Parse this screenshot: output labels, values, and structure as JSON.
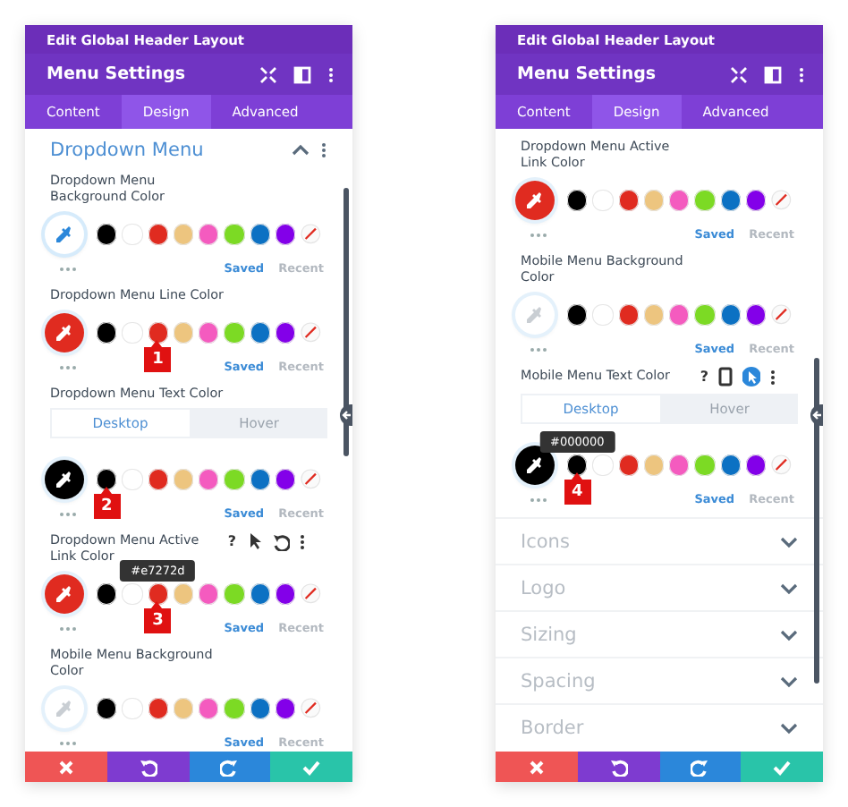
{
  "panels": [
    {
      "title": "Edit Global Header Layout",
      "subtitle": "Menu Settings",
      "tabs": [
        {
          "label": "Content",
          "selected": false
        },
        {
          "label": "Design",
          "selected": true
        },
        {
          "label": "Advanced",
          "selected": false
        }
      ],
      "items": [
        {
          "kind": "section",
          "label": "Dropdown Menu",
          "expanded": true
        },
        {
          "kind": "color",
          "label": "Dropdown Menu Background Color",
          "focused": true,
          "swatches": [
            {
              "kind": "color",
              "color": "#000000"
            },
            {
              "kind": "color",
              "color": "#ffffff"
            },
            {
              "kind": "color",
              "color": "#e02b20"
            },
            {
              "kind": "color",
              "color": "#edc57f"
            },
            {
              "kind": "color",
              "color": "#f45bbf"
            },
            {
              "kind": "color",
              "color": "#7cda24"
            },
            {
              "kind": "color",
              "color": "#0c71c3"
            },
            {
              "kind": "color",
              "color": "#8300e9"
            },
            {
              "kind": "clear"
            }
          ],
          "sources": [
            {
              "label": "Saved",
              "selected": true
            },
            {
              "label": "Recent",
              "selected": false
            }
          ]
        },
        {
          "kind": "color",
          "label": "Dropdown Menu Line Color",
          "color": "#e02b20",
          "focused": false,
          "swatches": [
            {
              "kind": "color",
              "color": "#000000"
            },
            {
              "kind": "color",
              "color": "#ffffff"
            },
            {
              "kind": "color",
              "color": "#e02b20",
              "callout": "1"
            },
            {
              "kind": "color",
              "color": "#edc57f"
            },
            {
              "kind": "color",
              "color": "#f45bbf"
            },
            {
              "kind": "color",
              "color": "#7cda24"
            },
            {
              "kind": "color",
              "color": "#0c71c3"
            },
            {
              "kind": "color",
              "color": "#8300e9"
            },
            {
              "kind": "clear"
            }
          ],
          "sources": [
            {
              "label": "Saved",
              "selected": true
            },
            {
              "label": "Recent",
              "selected": false
            }
          ]
        },
        {
          "kind": "color",
          "label": "Dropdown Menu Text Color",
          "color": "#000000",
          "focused": false,
          "devices": [
            {
              "label": "Desktop",
              "selected": true
            },
            {
              "label": "Hover",
              "selected": false
            }
          ],
          "swatches": [
            {
              "kind": "color",
              "color": "#000000",
              "callout": "2"
            },
            {
              "kind": "color",
              "color": "#ffffff"
            },
            {
              "kind": "color",
              "color": "#e02b20"
            },
            {
              "kind": "color",
              "color": "#edc57f"
            },
            {
              "kind": "color",
              "color": "#f45bbf"
            },
            {
              "kind": "color",
              "color": "#7cda24"
            },
            {
              "kind": "color",
              "color": "#0c71c3"
            },
            {
              "kind": "color",
              "color": "#8300e9"
            },
            {
              "kind": "clear"
            }
          ],
          "sources": [
            {
              "label": "Saved",
              "selected": true
            },
            {
              "label": "Recent",
              "selected": false
            }
          ]
        },
        {
          "kind": "color",
          "label": "Dropdown Menu Active Link Color",
          "color": "#e02b20",
          "focused": false,
          "tools": [
            {
              "kind": "help",
              "text": "?"
            },
            {
              "kind": "cursor",
              "active": false
            },
            {
              "kind": "reset"
            },
            {
              "kind": "more"
            }
          ],
          "swatches": [
            {
              "kind": "color",
              "color": "#000000"
            },
            {
              "kind": "color",
              "color": "#ffffff"
            },
            {
              "kind": "color",
              "color": "#e02b20",
              "tooltip": "#e7272d",
              "callout": "3"
            },
            {
              "kind": "color",
              "color": "#edc57f"
            },
            {
              "kind": "color",
              "color": "#f45bbf"
            },
            {
              "kind": "color",
              "color": "#7cda24"
            },
            {
              "kind": "color",
              "color": "#0c71c3"
            },
            {
              "kind": "color",
              "color": "#8300e9"
            },
            {
              "kind": "clear"
            }
          ],
          "sources": [
            {
              "label": "Saved",
              "selected": true
            },
            {
              "label": "Recent",
              "selected": false
            }
          ]
        },
        {
          "kind": "color",
          "label": "Mobile Menu Background Color",
          "focused": false,
          "swatches": [
            {
              "kind": "color",
              "color": "#000000"
            },
            {
              "kind": "color",
              "color": "#ffffff"
            },
            {
              "kind": "color",
              "color": "#e02b20"
            },
            {
              "kind": "color",
              "color": "#edc57f"
            },
            {
              "kind": "color",
              "color": "#f45bbf"
            },
            {
              "kind": "color",
              "color": "#7cda24"
            },
            {
              "kind": "color",
              "color": "#0c71c3"
            },
            {
              "kind": "color",
              "color": "#8300e9"
            },
            {
              "kind": "clear"
            }
          ],
          "sources": [
            {
              "label": "Saved",
              "selected": true
            },
            {
              "label": "Recent",
              "selected": false
            }
          ]
        }
      ]
    },
    {
      "title": "Edit Global Header Layout",
      "subtitle": "Menu Settings",
      "tabs": [
        {
          "label": "Content",
          "selected": false
        },
        {
          "label": "Design",
          "selected": true
        },
        {
          "label": "Advanced",
          "selected": false
        }
      ],
      "items": [
        {
          "kind": "color",
          "label": "Dropdown Menu Active Link Color",
          "color": "#e02b20",
          "focused": false,
          "swatches": [
            {
              "kind": "color",
              "color": "#000000"
            },
            {
              "kind": "color",
              "color": "#ffffff"
            },
            {
              "kind": "color",
              "color": "#e02b20"
            },
            {
              "kind": "color",
              "color": "#edc57f"
            },
            {
              "kind": "color",
              "color": "#f45bbf"
            },
            {
              "kind": "color",
              "color": "#7cda24"
            },
            {
              "kind": "color",
              "color": "#0c71c3"
            },
            {
              "kind": "color",
              "color": "#8300e9"
            },
            {
              "kind": "clear"
            }
          ],
          "sources": [
            {
              "label": "Saved",
              "selected": true
            },
            {
              "label": "Recent",
              "selected": false
            }
          ]
        },
        {
          "kind": "color",
          "label": "Mobile Menu Background Color",
          "focused": false,
          "swatches": [
            {
              "kind": "color",
              "color": "#000000"
            },
            {
              "kind": "color",
              "color": "#ffffff"
            },
            {
              "kind": "color",
              "color": "#e02b20"
            },
            {
              "kind": "color",
              "color": "#edc57f"
            },
            {
              "kind": "color",
              "color": "#f45bbf"
            },
            {
              "kind": "color",
              "color": "#7cda24"
            },
            {
              "kind": "color",
              "color": "#0c71c3"
            },
            {
              "kind": "color",
              "color": "#8300e9"
            },
            {
              "kind": "clear"
            }
          ],
          "sources": [
            {
              "label": "Saved",
              "selected": true
            },
            {
              "label": "Recent",
              "selected": false
            }
          ]
        },
        {
          "kind": "color",
          "label": "Mobile Menu Text Color",
          "color": "#000000",
          "focused": false,
          "tools": [
            {
              "kind": "help",
              "text": "?"
            },
            {
              "kind": "phone"
            },
            {
              "kind": "cursor",
              "active": true
            },
            {
              "kind": "more"
            }
          ],
          "devices": [
            {
              "label": "Desktop",
              "selected": true
            },
            {
              "label": "Hover",
              "selected": false
            }
          ],
          "swatches": [
            {
              "kind": "color",
              "color": "#000000",
              "tooltip": "#000000",
              "callout": "4"
            },
            {
              "kind": "color",
              "color": "#ffffff"
            },
            {
              "kind": "color",
              "color": "#e02b20"
            },
            {
              "kind": "color",
              "color": "#edc57f"
            },
            {
              "kind": "color",
              "color": "#f45bbf"
            },
            {
              "kind": "color",
              "color": "#7cda24"
            },
            {
              "kind": "color",
              "color": "#0c71c3"
            },
            {
              "kind": "color",
              "color": "#8300e9"
            },
            {
              "kind": "clear"
            }
          ],
          "sources": [
            {
              "label": "Saved",
              "selected": true
            },
            {
              "label": "Recent",
              "selected": false
            }
          ]
        },
        {
          "kind": "group",
          "label": "Icons",
          "expanded": false
        },
        {
          "kind": "group",
          "label": "Logo",
          "expanded": false
        },
        {
          "kind": "group",
          "label": "Sizing",
          "expanded": false
        },
        {
          "kind": "group",
          "label": "Spacing",
          "expanded": false
        },
        {
          "kind": "group",
          "label": "Border",
          "expanded": false
        }
      ]
    }
  ],
  "footer": [
    {
      "kind": "cancel"
    },
    {
      "kind": "undo"
    },
    {
      "kind": "redo"
    },
    {
      "kind": "save"
    }
  ]
}
